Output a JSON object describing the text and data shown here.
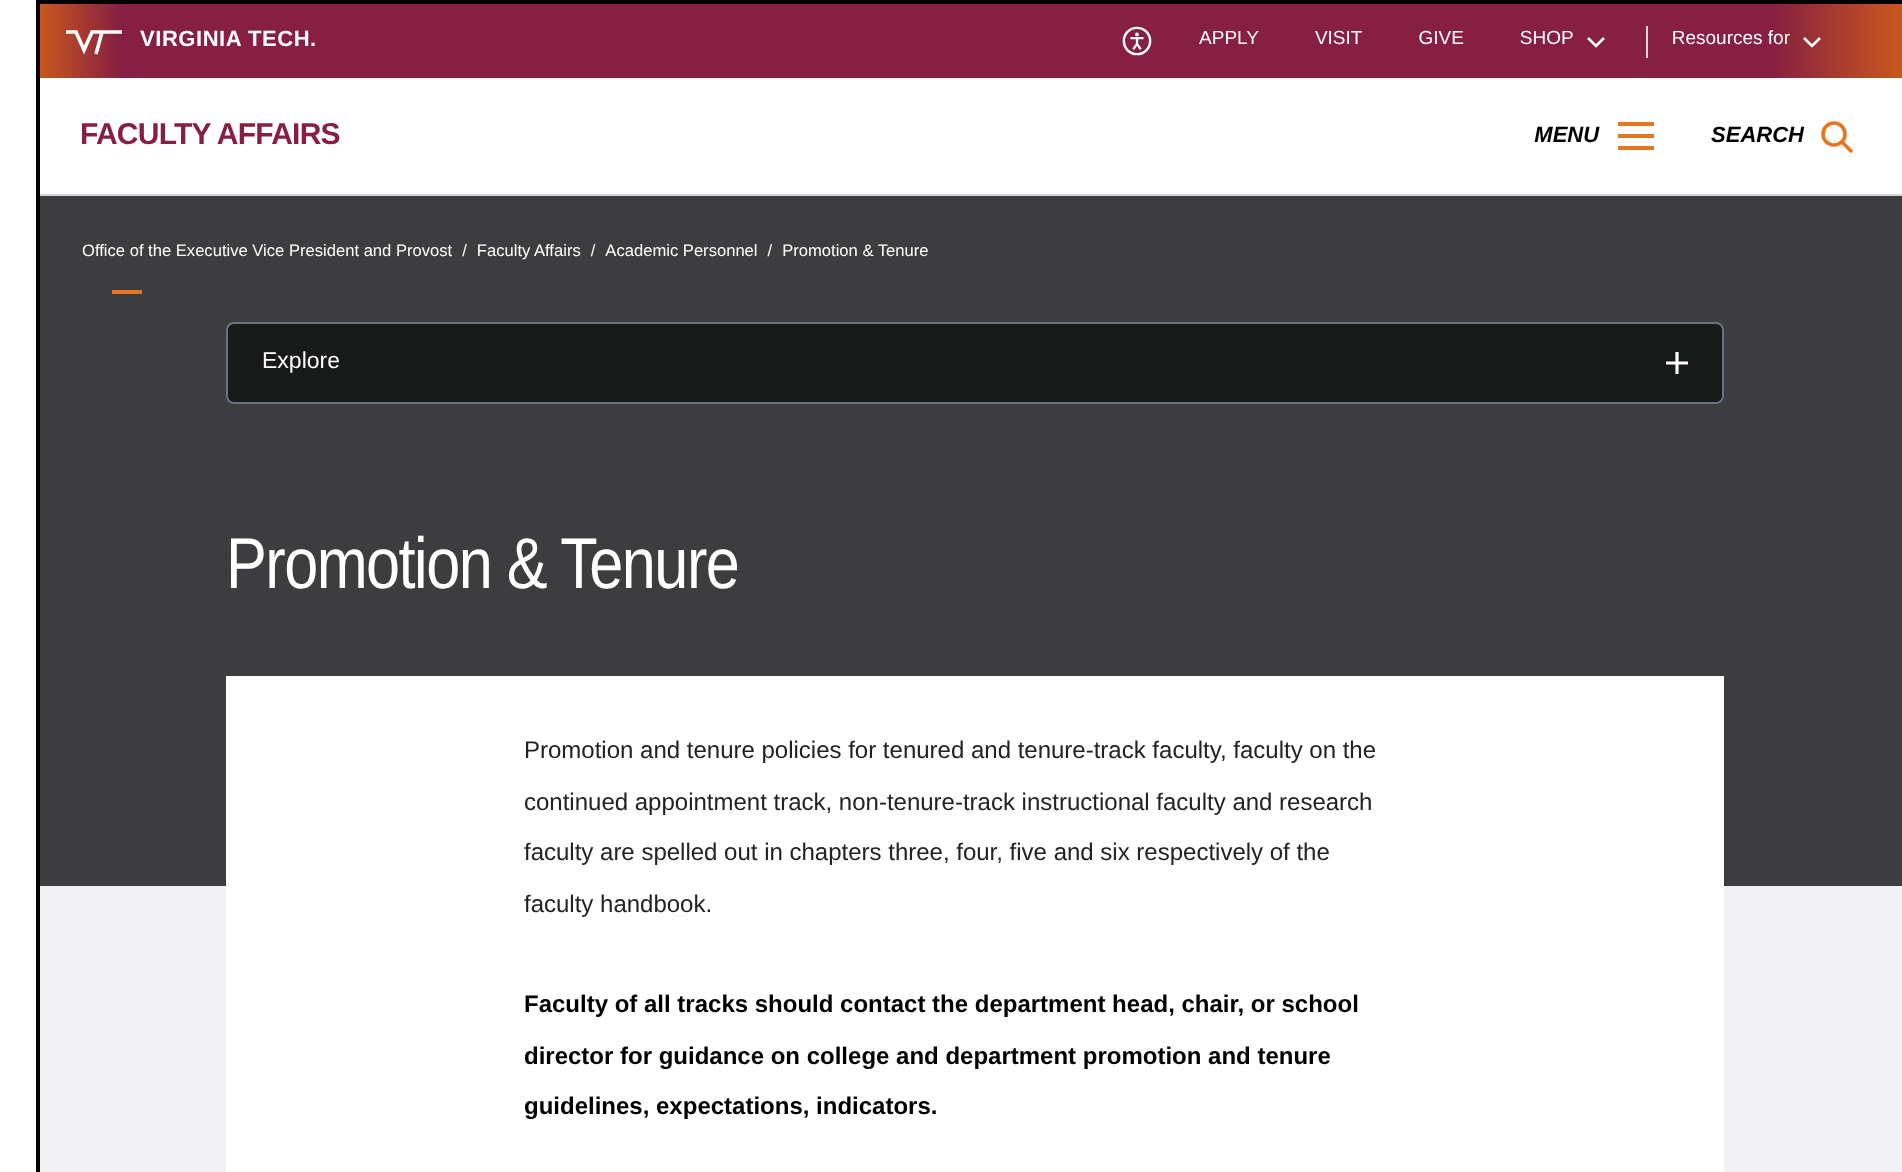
{
  "top_bar": {
    "logo": "VIRGINIA TECH.",
    "links": [
      {
        "label": "APPLY",
        "dropdown": false
      },
      {
        "label": "VISIT",
        "dropdown": false
      },
      {
        "label": "GIVE",
        "dropdown": false
      },
      {
        "label": "SHOP",
        "dropdown": true
      },
      {
        "label": "Resources for",
        "dropdown": true
      }
    ]
  },
  "header": {
    "site_title": "FACULTY AFFAIRS",
    "menu": "MENU",
    "search": "SEARCH"
  },
  "breadcrumb_separator": "/",
  "breadcrumbs": [
    "Office of the Executive Vice President and Provost",
    "Faculty Affairs",
    "Academic Personnel",
    "Promotion & Tenure"
  ],
  "explore": {
    "label": "Explore",
    "expanded": false
  },
  "page_title": "Promotion & Tenure",
  "paragraphs": [
    {
      "text": "Promotion and tenure policies for tenured and tenure-track faculty, faculty on the continued appointment track, non-tenure-track instructional faculty and research faculty are spelled out in chapters three, four, five and six respectively of the faculty handbook.",
      "bold": false
    },
    {
      "text": "Faculty of all tracks should contact the department head, chair, or school director for guidance on college and department promotion and tenure guidelines, expectations, indicators.",
      "bold": true
    }
  ]
}
